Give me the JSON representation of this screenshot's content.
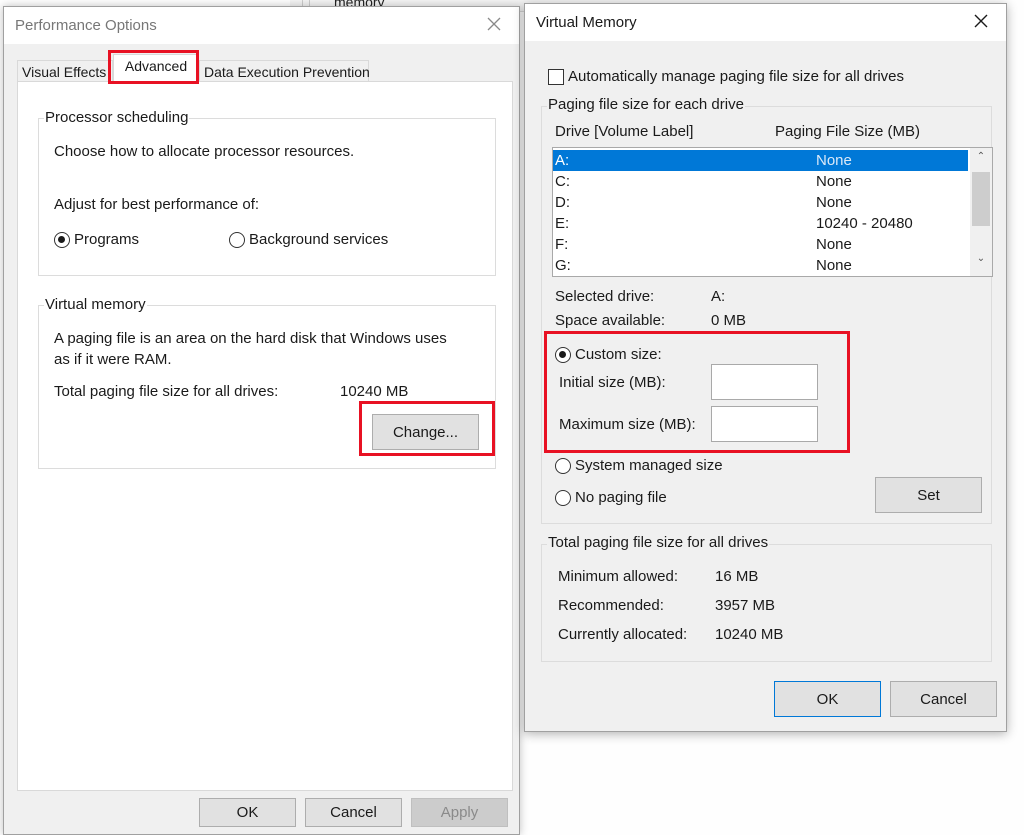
{
  "background": {
    "partial_text": "memory"
  },
  "performance_options": {
    "title": "Performance Options",
    "tabs": [
      {
        "label": "Visual Effects",
        "active": false
      },
      {
        "label": "Advanced",
        "active": true
      },
      {
        "label": "Data Execution Prevention",
        "active": false
      }
    ],
    "processor_scheduling": {
      "group_label": "Processor scheduling",
      "description": "Choose how to allocate processor resources.",
      "adjust_label": "Adjust for best performance of:",
      "options": [
        {
          "label": "Programs",
          "selected": true
        },
        {
          "label": "Background services",
          "selected": false
        }
      ]
    },
    "virtual_memory": {
      "group_label": "Virtual memory",
      "description_line1": "A paging file is an area on the hard disk that Windows uses",
      "description_line2": "as if it were RAM.",
      "total_label": "Total paging file size for all drives:",
      "total_value": "10240 MB",
      "change_button": "Change..."
    },
    "buttons": {
      "ok": "OK",
      "cancel": "Cancel",
      "apply": "Apply"
    }
  },
  "virtual_memory_dialog": {
    "title": "Virtual Memory",
    "auto_manage": {
      "label": "Automatically manage paging file size for all drives",
      "checked": false
    },
    "per_drive": {
      "group_label": "Paging file size for each drive",
      "columns": [
        "Drive  [Volume Label]",
        "Paging File Size (MB)"
      ],
      "drives": [
        {
          "drive": "A:",
          "size": "None",
          "selected": true
        },
        {
          "drive": "C:",
          "size": "None",
          "selected": false
        },
        {
          "drive": "D:",
          "size": "None",
          "selected": false
        },
        {
          "drive": "E:",
          "size": "10240 - 20480",
          "selected": false
        },
        {
          "drive": "F:",
          "size": "None",
          "selected": false
        },
        {
          "drive": "G:",
          "size": "None",
          "selected": false
        }
      ],
      "selected_drive_label": "Selected drive:",
      "selected_drive_value": "A:",
      "space_available_label": "Space available:",
      "space_available_value": "0 MB",
      "options": {
        "custom_size": {
          "label": "Custom size:",
          "selected": true
        },
        "system_managed": {
          "label": "System managed size",
          "selected": false
        },
        "no_paging": {
          "label": "No paging file",
          "selected": false
        }
      },
      "initial_size": {
        "label": "Initial size (MB):",
        "value": ""
      },
      "maximum_size": {
        "label": "Maximum size (MB):",
        "value": ""
      },
      "set_button": "Set"
    },
    "totals": {
      "group_label": "Total paging file size for all drives",
      "minimum_label": "Minimum allowed:",
      "minimum_value": "16 MB",
      "recommended_label": "Recommended:",
      "recommended_value": "3957 MB",
      "allocated_label": "Currently allocated:",
      "allocated_value": "10240 MB"
    },
    "buttons": {
      "ok": "OK",
      "cancel": "Cancel"
    }
  },
  "annotation_color": "#e81123",
  "selection_color": "#0078d7"
}
